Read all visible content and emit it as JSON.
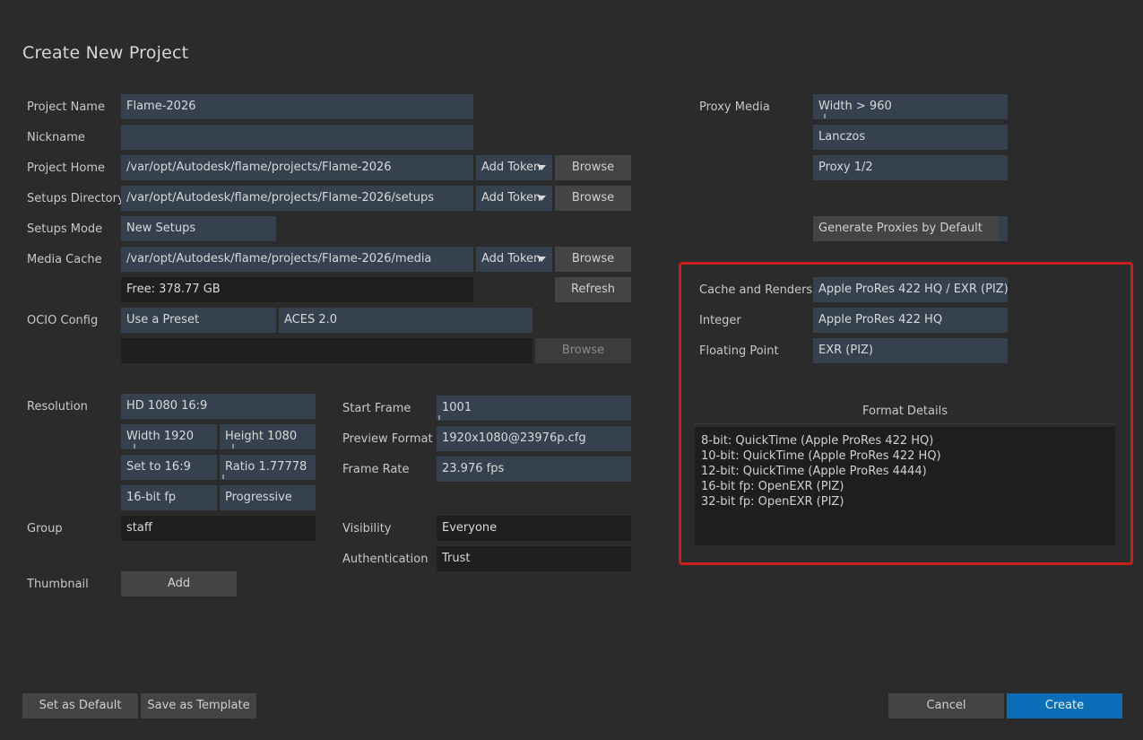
{
  "dialog": {
    "title": "Create New Project"
  },
  "left": {
    "project_name": {
      "label": "Project Name",
      "value": "Flame-2026"
    },
    "nickname": {
      "label": "Nickname",
      "value": ""
    },
    "project_home": {
      "label": "Project Home",
      "value": "/var/opt/Autodesk/flame/projects/Flame-2026",
      "token": "Add Token",
      "browse": "Browse"
    },
    "setups_directory": {
      "label": "Setups Directory",
      "value": "/var/opt/Autodesk/flame/projects/Flame-2026/setups",
      "token": "Add Token",
      "browse": "Browse"
    },
    "setups_mode": {
      "label": "Setups Mode",
      "value": "New Setups"
    },
    "media_cache": {
      "label": "Media Cache",
      "value": "/var/opt/Autodesk/flame/projects/Flame-2026/media",
      "token": "Add Token",
      "browse": "Browse",
      "free": "Free: 378.77 GB",
      "refresh": "Refresh"
    },
    "ocio_config": {
      "label": "OCIO Config",
      "mode": "Use a Preset",
      "preset": "ACES 2.0",
      "path": "",
      "browse": "Browse"
    },
    "resolution": {
      "label": "Resolution",
      "preset": "HD 1080 16:9",
      "width": "Width 1920",
      "height": "Height 1080",
      "set_aspect": "Set to 16:9",
      "ratio": "Ratio 1.77778",
      "depth": "16-bit fp",
      "scan": "Progressive"
    },
    "group": {
      "label": "Group",
      "value": "staff"
    },
    "thumbnail": {
      "label": "Thumbnail",
      "button": "Add"
    }
  },
  "middle": {
    "start_frame": {
      "label": "Start Frame",
      "value": "1001"
    },
    "preview_format": {
      "label": "Preview Format",
      "value": "1920x1080@23976p.cfg"
    },
    "frame_rate": {
      "label": "Frame Rate",
      "value": "23.976 fps"
    },
    "visibility": {
      "label": "Visibility",
      "value": "Everyone"
    },
    "authentication": {
      "label": "Authentication",
      "value": "Trust"
    }
  },
  "right": {
    "proxy_media": {
      "label": "Proxy Media",
      "width": "Width > 960",
      "filter": "Lanczos",
      "scale": "Proxy 1/2",
      "generate": "Generate Proxies by Default"
    },
    "cache": {
      "cache_renders": {
        "label": "Cache and Renders",
        "value": "Apple ProRes 422 HQ / EXR (PIZ)"
      },
      "integer": {
        "label": "Integer",
        "value": "Apple ProRes 422 HQ"
      },
      "floating": {
        "label": "Floating Point",
        "value": "EXR (PIZ)"
      },
      "details_title": "Format Details",
      "details": [
        "8-bit: QuickTime (Apple ProRes 422 HQ)",
        "10-bit: QuickTime (Apple ProRes 422 HQ)",
        "12-bit: QuickTime (Apple ProRes 4444)",
        "16-bit fp: OpenEXR (PIZ)",
        "32-bit fp: OpenEXR (PIZ)"
      ]
    }
  },
  "footer": {
    "set_default": "Set as Default",
    "save_template": "Save as Template",
    "cancel": "Cancel",
    "create": "Create"
  },
  "colors": {
    "background": "#2b2b2b",
    "field": "#364150",
    "button": "#444444",
    "primary": "#0a6fb8",
    "highlight": "#c81e1e"
  }
}
